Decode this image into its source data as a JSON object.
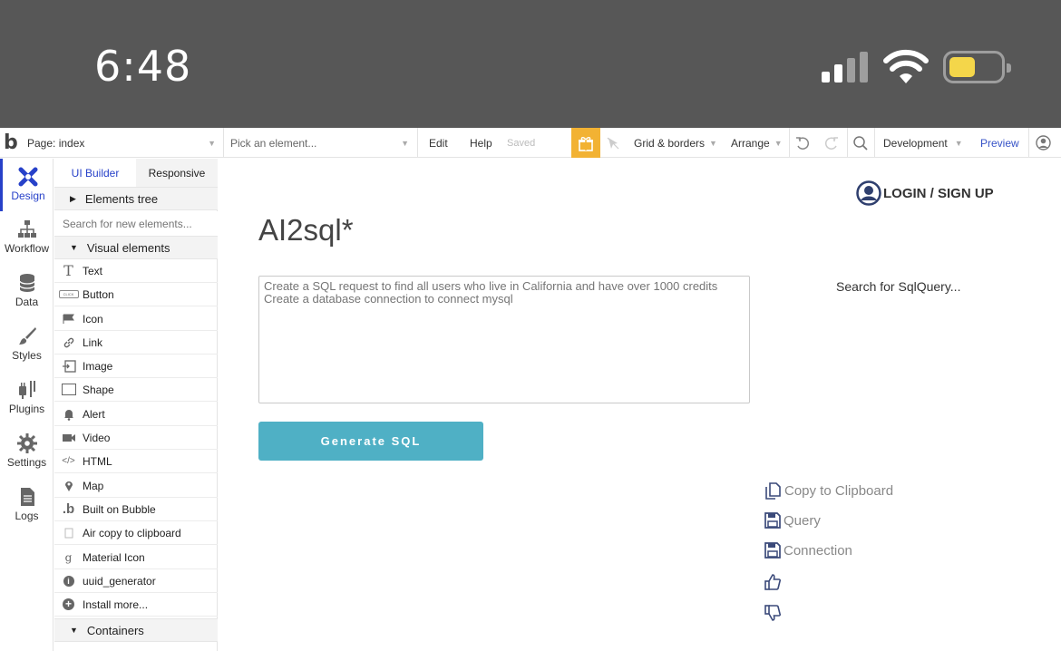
{
  "status_bar": {
    "time": "6:48"
  },
  "toolbar": {
    "logo": "b",
    "page_select": "Page: index",
    "element_picker_placeholder": "Pick an element...",
    "edit": "Edit",
    "help": "Help",
    "saved": "Saved",
    "grid_borders": "Grid & borders",
    "arrange": "Arrange",
    "version": "Development",
    "preview": "Preview"
  },
  "leftnav": [
    {
      "label": "Design",
      "icon": "design-icon"
    },
    {
      "label": "Workflow",
      "icon": "workflow-icon"
    },
    {
      "label": "Data",
      "icon": "database-icon"
    },
    {
      "label": "Styles",
      "icon": "brush-icon"
    },
    {
      "label": "Plugins",
      "icon": "plug-icon"
    },
    {
      "label": "Settings",
      "icon": "gear-icon"
    },
    {
      "label": "Logs",
      "icon": "document-icon"
    }
  ],
  "panel": {
    "tab_ui_builder": "UI Builder",
    "tab_responsive": "Responsive",
    "elements_tree": "Elements tree",
    "search_placeholder": "Search for new elements...",
    "visual_elements": "Visual elements",
    "items": [
      {
        "label": "Text",
        "icon": "text-icon"
      },
      {
        "label": "Button",
        "icon": "button-icon"
      },
      {
        "label": "Icon",
        "icon": "flag-icon"
      },
      {
        "label": "Link",
        "icon": "link-icon"
      },
      {
        "label": "Image",
        "icon": "image-icon"
      },
      {
        "label": "Shape",
        "icon": "shape-icon"
      },
      {
        "label": "Alert",
        "icon": "bell-icon"
      },
      {
        "label": "Video",
        "icon": "video-icon"
      },
      {
        "label": "HTML",
        "icon": "code-icon"
      },
      {
        "label": "Map",
        "icon": "map-pin-icon"
      },
      {
        "label": "Built on Bubble",
        "icon": "bubble-icon"
      },
      {
        "label": "Air copy to clipboard",
        "icon": "clipboard-icon"
      },
      {
        "label": "Material Icon",
        "icon": "material-icon"
      },
      {
        "label": "uuid_generator",
        "icon": "info-icon"
      },
      {
        "label": "Install more...",
        "icon": "plus-circle-icon"
      }
    ],
    "containers": "Containers"
  },
  "canvas": {
    "login": "LOGIN / SIGN UP",
    "title": "AI2sql*",
    "prompt_placeholder": "Create a SQL request to find all users who live in California and have over 1000 credits\nCreate a database connection to connect mysql",
    "generate_button": "Generate SQL",
    "search_sql": "Search for SqlQuery...",
    "actions": [
      {
        "label": "Copy to Clipboard",
        "icon": "copy-icon"
      },
      {
        "label": "Query",
        "icon": "save-icon"
      },
      {
        "label": "Connection",
        "icon": "save-icon"
      },
      {
        "label": "",
        "icon": "thumbs-up-icon"
      },
      {
        "label": "",
        "icon": "thumbs-down-icon"
      }
    ]
  },
  "colors": {
    "status_bar_bg": "#575757",
    "accent_blue": "#2741c9",
    "generate_button": "#4fb0c5",
    "gift": "#f2b233",
    "battery": "#f4d64a"
  }
}
